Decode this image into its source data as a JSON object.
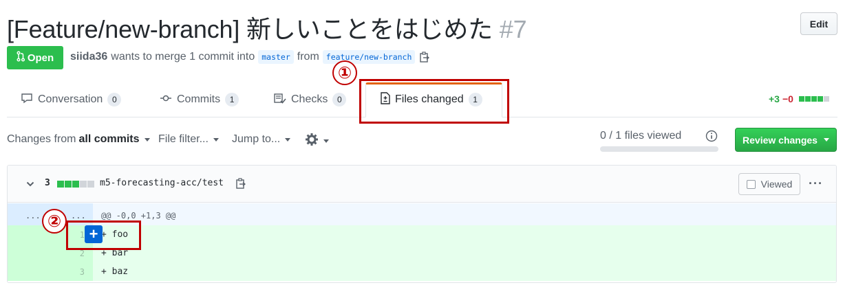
{
  "pr": {
    "title": "[Feature/new-branch] 新しいことをはじめた",
    "number": "#7",
    "edit_label": "Edit",
    "state": "Open",
    "author": "siida36",
    "merge_text_a": "wants to merge 1 commit into",
    "base_branch": "master",
    "from_text": "from",
    "head_branch": "feature/new-branch"
  },
  "tabs": [
    {
      "label": "Conversation",
      "count": "0"
    },
    {
      "label": "Commits",
      "count": "1"
    },
    {
      "label": "Checks",
      "count": "0"
    },
    {
      "label": "Files changed",
      "count": "1"
    }
  ],
  "diffstat": {
    "additions": "+3",
    "deletions": "−0"
  },
  "toolbar": {
    "changes_from": "Changes from",
    "all_commits": "all commits",
    "file_filter": "File filter...",
    "jump_to": "Jump to...",
    "files_viewed": "0 / 1 files viewed",
    "files_viewed_fraction": 0,
    "review_changes": "Review changes"
  },
  "file": {
    "change_count": "3",
    "path": "m5-forecasting-acc/test",
    "viewed_label": "Viewed",
    "hunk_header": "@@ -0,0 +1,3 @@",
    "expander_left": "...",
    "expander_right": "...",
    "lines": [
      {
        "num": "1",
        "code": "+ foo"
      },
      {
        "num": "2",
        "code": "+ bar"
      },
      {
        "num": "3",
        "code": "+ baz"
      }
    ]
  },
  "annotations": {
    "one": "①",
    "two": "②"
  },
  "colors": {
    "open_green": "#2cbe4e",
    "review_green": "#28a745",
    "annotation_red": "#c00000",
    "link_blue": "#0366d6"
  }
}
